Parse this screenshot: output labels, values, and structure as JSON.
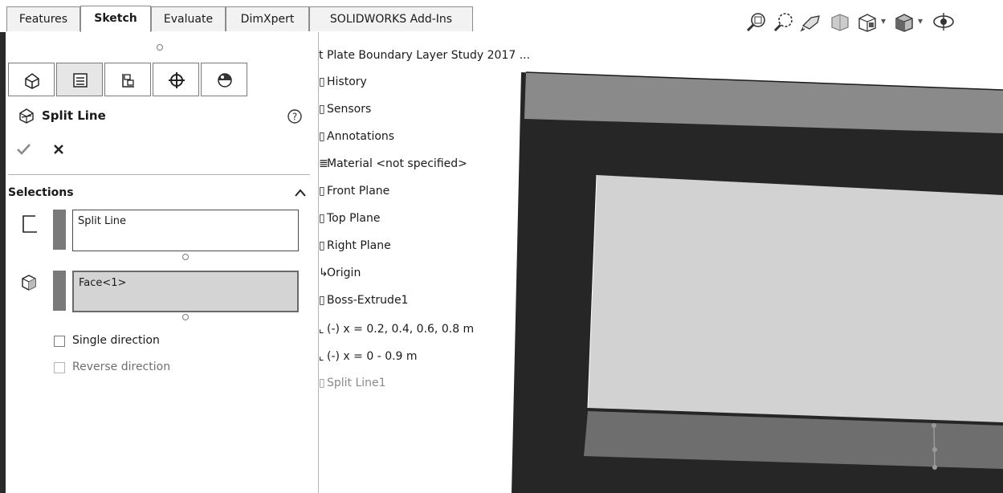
{
  "tabs": [
    {
      "label": "Features"
    },
    {
      "label": "Sketch",
      "active": true
    },
    {
      "label": "Evaluate"
    },
    {
      "label": "DimXpert"
    },
    {
      "label": "SOLIDWORKS Add-Ins"
    }
  ],
  "view_toolbar": {
    "icons": [
      "zoom-to-fit-icon",
      "zoom-to-area-icon",
      "previous-view-icon",
      "section-view-icon",
      "view-orientation-icon",
      "display-style-icon",
      "hide-show-items-icon"
    ]
  },
  "property_manager": {
    "tab_icons": [
      "feature-manager-icon",
      "property-manager-icon",
      "configuration-manager-icon",
      "dimxpert-manager-icon",
      "display-manager-icon"
    ],
    "feature_title": "Split Line",
    "help_icon": "help-icon",
    "ok_icon": "ok-checkmark-icon",
    "cancel_icon": "cancel-x-icon",
    "selections_header": "Selections",
    "split_line_box": "Split Line",
    "face_box": "Face<1>",
    "single_direction_label": "Single direction",
    "single_direction_checked": false,
    "reverse_direction_label": "Reverse direction",
    "reverse_direction_enabled": false
  },
  "feature_tree": {
    "part_name": "t Plate Boundary Layer Study 2017 ...",
    "items": [
      {
        "label": "History",
        "icon": "history-icon"
      },
      {
        "label": "Sensors",
        "icon": "sensors-icon"
      },
      {
        "label": "Annotations",
        "icon": "annotations-icon"
      },
      {
        "label": "Material <not specified>",
        "icon": "material-icon"
      },
      {
        "label": "Front Plane",
        "icon": "plane-icon"
      },
      {
        "label": "Top Plane",
        "icon": "plane-icon"
      },
      {
        "label": "Right Plane",
        "icon": "plane-icon"
      },
      {
        "label": "Origin",
        "icon": "origin-icon"
      },
      {
        "label": "Boss-Extrude1",
        "icon": "boss-extrude-icon"
      },
      {
        "label": "(-) x = 0.2, 0.4, 0.6, 0.8 m",
        "icon": "sketch-icon"
      },
      {
        "label": "(-) x = 0 - 0.9 m",
        "icon": "sketch-icon"
      },
      {
        "label": "Split Line1",
        "icon": "split-line-icon",
        "greyed": true
      }
    ]
  },
  "colors": {
    "model_dark": "#262626",
    "model_top": "#8a8a8a",
    "model_face": "#d2d2d2",
    "model_bottom": "#6e6e6e"
  }
}
